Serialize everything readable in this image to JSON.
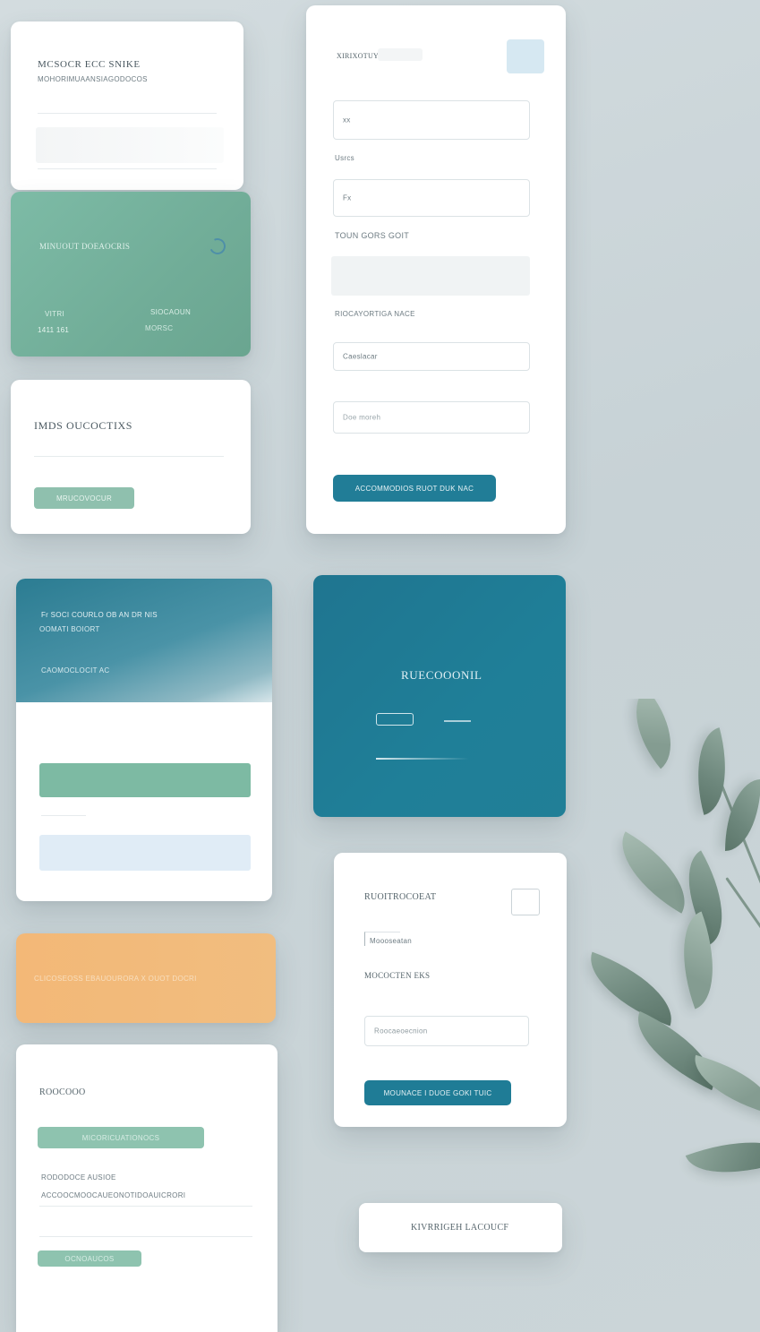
{
  "card_a": {
    "title": "MCSOCR ECC SNIKE",
    "subtitle": "MOHORIMUAANSIAGODOCOS"
  },
  "card_green": {
    "title": "MINUOUT DOEAOCRIS",
    "col1_top": "VITRI",
    "col1_bottom": "1411 161",
    "col2_top": "SIOCAOUN",
    "col2_bottom": "MORSC"
  },
  "card_e": {
    "title": "IMDS OUCOCTIXS",
    "button_label": "MRUCOVOCUR"
  },
  "form": {
    "title": "XIRIXOTUYS",
    "field1_placeholder": "xx",
    "label2": "Usrcs",
    "field2_placeholder": "Fx",
    "label3": "TOUN GORS GOIT",
    "label4": "RIOCAYORTIGA NACE",
    "field4_placeholder": "Caeslacar",
    "field5_placeholder": "Doe moreh",
    "submit_label": "ACCOMMODIOS RUOT DUK NAC"
  },
  "card_hero": {
    "line1": "Fr SOCI COURLO OB AN DR NIS",
    "line2": "OOMATI BOIORT",
    "line3": "CAOMOCLOCIT AC"
  },
  "card_teal": {
    "title": "RUECOOONIL"
  },
  "card_orange": {
    "text": "CLICOSEOSS EBAUOURORA X OUOT DOCRI"
  },
  "card_bottom": {
    "title": "ROOCOOO",
    "button_label": "MICORICUATIONOCS",
    "label2": "RODODOCE AUSIOE",
    "label3": "ACCOOCMOOCAUEONOTIDOAUICRORI",
    "button2_label": "OCNOAUCOS"
  },
  "card_login": {
    "title": "RUOITROCOEAT",
    "field1_label": "Moooseatan",
    "label2": "MOCOCTEN EKS",
    "field2_placeholder": "Roocaeoecnion",
    "button_label": "MOUNACE I DUOE GOKI TUIC"
  },
  "chip": {
    "label": "KIVRRIGEH LACOUCF"
  },
  "colors": {
    "background": "#cbd5d8",
    "teal": "#1f7c96",
    "green": "#79b4a1",
    "orange": "#f2b876",
    "leaf": "#6d877c"
  },
  "icons": {
    "green_card_icon": "moon-icon",
    "login_checkbox": "checkbox-icon"
  }
}
